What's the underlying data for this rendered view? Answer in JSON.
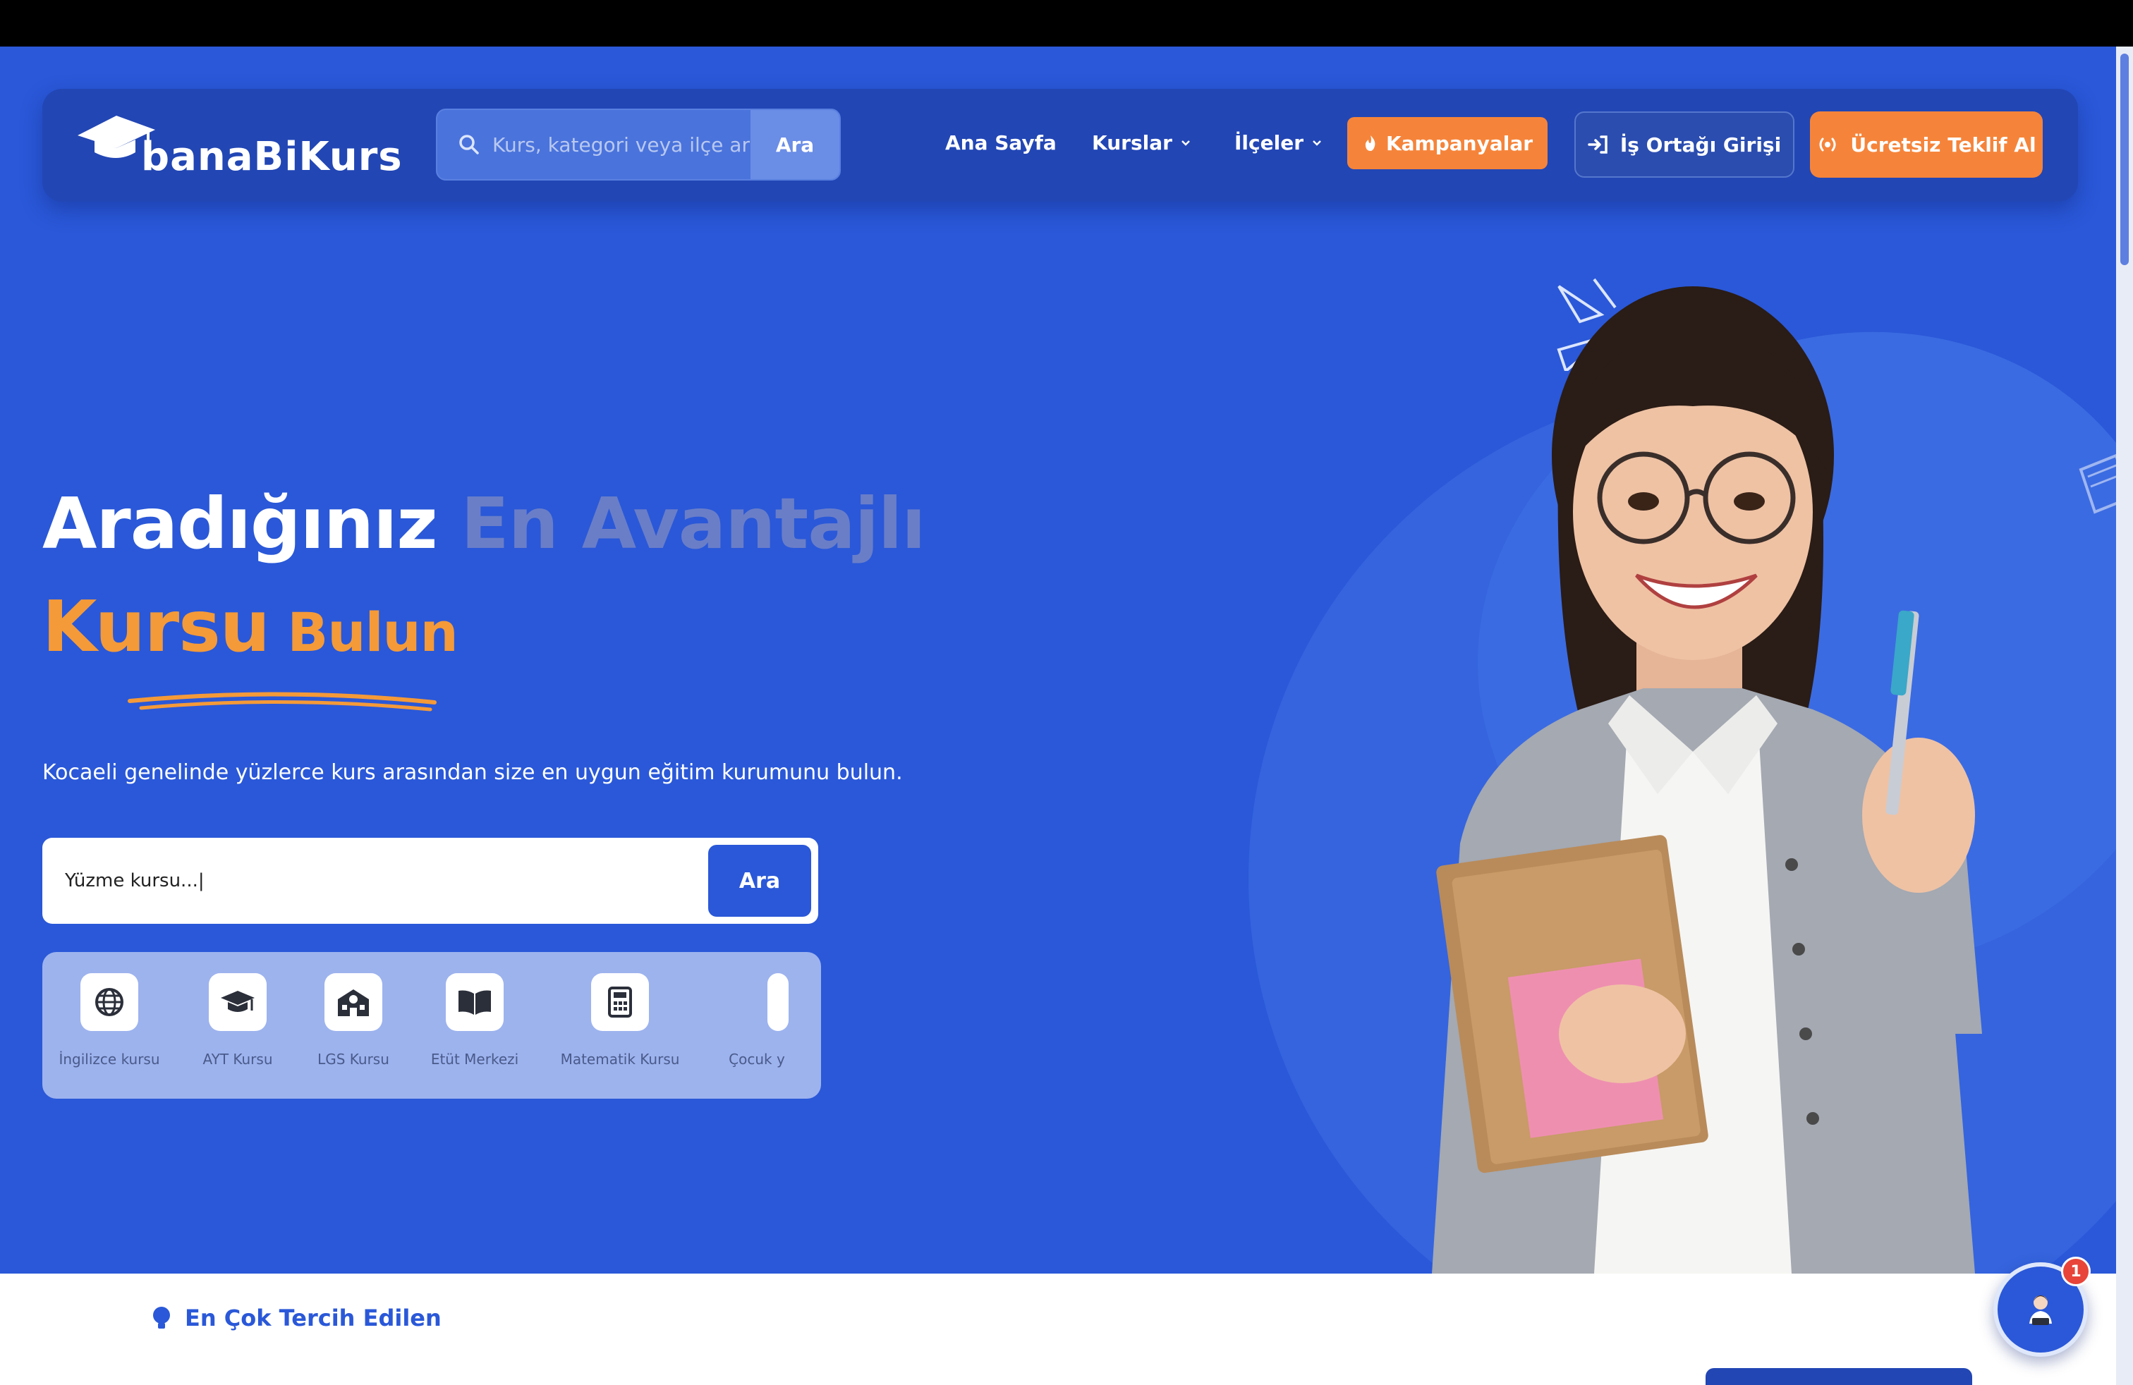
{
  "brand": {
    "name": "banaBiKurs"
  },
  "nav": {
    "search_placeholder": "Kurs, kategori veya ilçe ara",
    "search_button": "Ara",
    "links": {
      "home": "Ana Sayfa",
      "courses": "Kurslar",
      "districts": "İlçeler"
    },
    "campaigns": "Kampanyalar",
    "partner_login": "İş Ortağı Girişi",
    "free_offer": "Ücretsiz Teklif Al"
  },
  "hero": {
    "headline_line1_main": "Aradığınız ",
    "headline_line1_muted": "En Avantajlı",
    "headline_line2_main": "Kursu",
    "headline_line2_small": " Bulun",
    "subtitle": "Kocaeli genelinde yüzlerce kurs arasından size en uygun eğitim kurumunu bulun.",
    "search_value": "Yüzme kursu...|",
    "search_button": "Ara",
    "categories": [
      {
        "label": "İngilizce kursu",
        "icon": "globe-icon"
      },
      {
        "label": "AYT Kursu",
        "icon": "graduation-cap-icon"
      },
      {
        "label": "LGS Kursu",
        "icon": "school-icon"
      },
      {
        "label": "Etüt Merkezi",
        "icon": "book-open-icon"
      },
      {
        "label": "Matematik Kursu",
        "icon": "calculator-icon"
      },
      {
        "label": "Çocuk y",
        "icon": "partial-icon"
      }
    ]
  },
  "section": {
    "tag": "En Çok Tercih Edilen"
  },
  "chat": {
    "badge_count": "1"
  },
  "colors": {
    "hero_bg": "#2a58d8",
    "navbar_bg": "#2246b4",
    "accent_orange": "#f5843a",
    "headline_orange": "#f59a38",
    "muted_heading": "#6a7ec8"
  }
}
